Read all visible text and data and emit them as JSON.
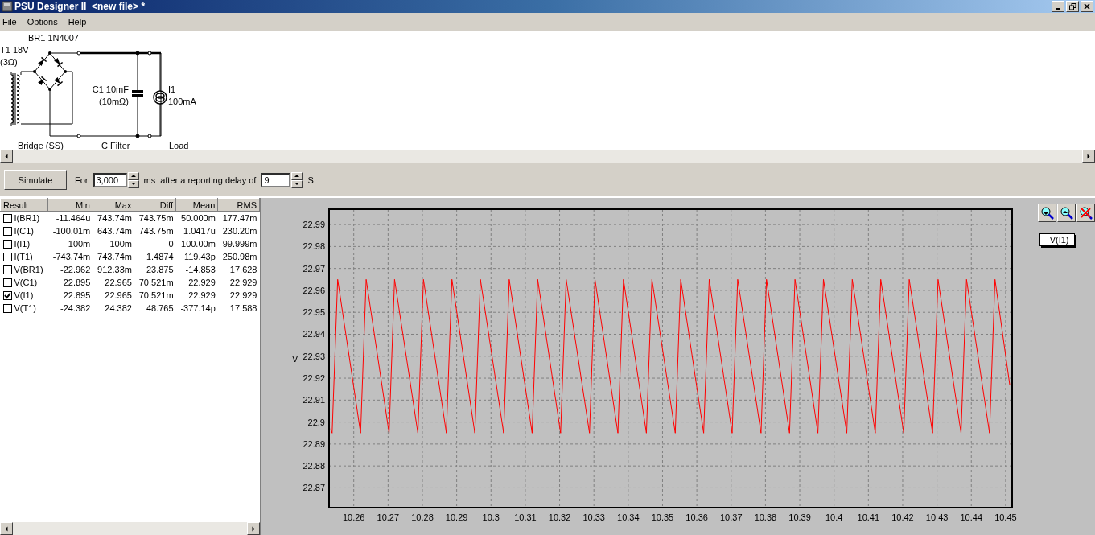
{
  "window": {
    "title": "PSU Designer II  <new file> *"
  },
  "menu": [
    "File",
    "Options",
    "Help"
  ],
  "schematic": {
    "transformer": {
      "name": "T1 18V",
      "resistance": "(3Ω)"
    },
    "bridge": {
      "name": "BR1 1N4007",
      "caption": "Bridge (SS)"
    },
    "capacitor": {
      "name": "C1 10mF",
      "esr": "(10mΩ)",
      "caption": "C Filter"
    },
    "load": {
      "name": "I1",
      "value": "100mA",
      "caption": "Load"
    }
  },
  "simulate": {
    "button": "Simulate",
    "for_label": "For",
    "duration": "3,000",
    "duration_unit": "ms",
    "delay_label": "after a reporting delay of",
    "delay": "9",
    "delay_unit": "S"
  },
  "results": {
    "columns": [
      "Result",
      "Min",
      "Max",
      "Diff",
      "Mean",
      "RMS"
    ],
    "rows": [
      {
        "name": "I(BR1)",
        "checked": false,
        "values": [
          "-11.464u",
          "743.74m",
          "743.75m",
          "50.000m",
          "177.47m"
        ]
      },
      {
        "name": "I(C1)",
        "checked": false,
        "values": [
          "-100.01m",
          "643.74m",
          "743.75m",
          "1.0417u",
          "230.20m"
        ]
      },
      {
        "name": "I(I1)",
        "checked": false,
        "values": [
          "100m",
          "100m",
          "0",
          "100.00m",
          "99.999m"
        ]
      },
      {
        "name": "I(T1)",
        "checked": false,
        "values": [
          "-743.74m",
          "743.74m",
          "1.4874",
          "119.43p",
          "250.98m"
        ]
      },
      {
        "name": "V(BR1)",
        "checked": false,
        "values": [
          "-22.962",
          "912.33m",
          "23.875",
          "-14.853",
          "17.628"
        ]
      },
      {
        "name": "V(C1)",
        "checked": false,
        "values": [
          "22.895",
          "22.965",
          "70.521m",
          "22.929",
          "22.929"
        ]
      },
      {
        "name": "V(I1)",
        "checked": true,
        "values": [
          "22.895",
          "22.965",
          "70.521m",
          "22.929",
          "22.929"
        ]
      },
      {
        "name": "V(T1)",
        "checked": false,
        "values": [
          "-24.382",
          "24.382",
          "48.765",
          "-377.14p",
          "17.588"
        ]
      }
    ]
  },
  "legend": {
    "marker": "-"
  },
  "chart_data": {
    "type": "line",
    "ylabel": "V",
    "grid": true,
    "x": [
      10.2533,
      10.2537,
      10.2553,
      10.262,
      10.2636,
      10.2703,
      10.2719,
      10.2787,
      10.2803,
      10.287,
      10.2886,
      10.2953,
      10.2969,
      10.3037,
      10.3053,
      10.312,
      10.3136,
      10.3203,
      10.3219,
      10.3287,
      10.3303,
      10.337,
      10.3386,
      10.3453,
      10.3469,
      10.3537,
      10.3553,
      10.362,
      10.3636,
      10.3703,
      10.3719,
      10.3787,
      10.3803,
      10.387,
      10.3886,
      10.3953,
      10.3969,
      10.4037,
      10.4053,
      10.412,
      10.4136,
      10.4203,
      10.4219,
      10.4287,
      10.4303,
      10.437,
      10.4386,
      10.4453,
      10.4469,
      10.4512
    ],
    "series": [
      {
        "name": "V(I1)",
        "color": "#ff0000",
        "values": [
          22.897,
          22.895,
          22.965,
          22.895,
          22.965,
          22.895,
          22.965,
          22.895,
          22.965,
          22.895,
          22.965,
          22.895,
          22.965,
          22.895,
          22.965,
          22.895,
          22.965,
          22.895,
          22.965,
          22.895,
          22.965,
          22.895,
          22.965,
          22.895,
          22.965,
          22.895,
          22.965,
          22.895,
          22.965,
          22.895,
          22.965,
          22.895,
          22.965,
          22.895,
          22.965,
          22.895,
          22.965,
          22.895,
          22.965,
          22.895,
          22.965,
          22.895,
          22.965,
          22.895,
          22.965,
          22.895,
          22.965,
          22.895,
          22.965,
          22.917
        ]
      }
    ],
    "xlim": [
      10.2528,
      10.4519
    ],
    "ylim": [
      22.861,
      22.997
    ],
    "xticks": [
      10.26,
      10.27,
      10.28,
      10.29,
      10.3,
      10.31,
      10.32,
      10.33,
      10.34,
      10.35,
      10.36,
      10.37,
      10.38,
      10.39,
      10.4,
      10.41,
      10.42,
      10.43,
      10.44,
      10.45
    ],
    "yticks": [
      22.87,
      22.88,
      22.89,
      22.9,
      22.91,
      22.92,
      22.93,
      22.94,
      22.95,
      22.96,
      22.97,
      22.98,
      22.99
    ]
  }
}
